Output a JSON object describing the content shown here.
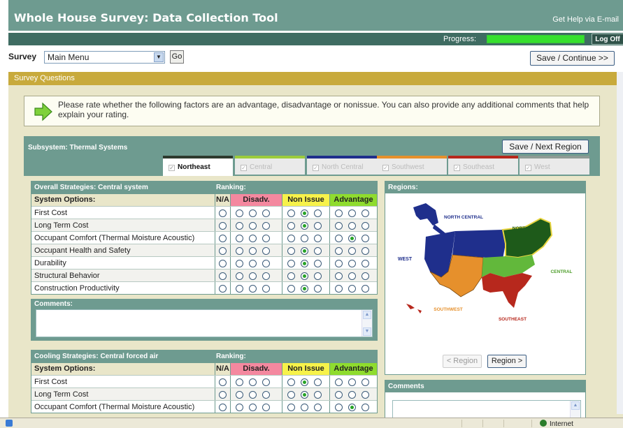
{
  "header": {
    "title": "Whole House Survey: Data Collection Tool",
    "help_link": "Get Help via E-mail"
  },
  "progress": {
    "label": "Progress:",
    "value_fraction": 1.0,
    "logoff_label": "Log Off"
  },
  "survey_bar": {
    "label": "Survey",
    "selected": "Main Menu",
    "go_label": "Go",
    "save_continue_label": "Save / Continue >>"
  },
  "section": {
    "title": "Survey Questions"
  },
  "instructions": "Please rate whether the following factors are an advantage, disadvantage or nonissue. You can also provide any additional comments that help explain your rating.",
  "subsystem": {
    "title": "Subsystem: Thermal Systems",
    "save_next_label": "Save / Next Region",
    "tabs": [
      {
        "label": "Northeast",
        "color": "#2e3a2e",
        "active": true
      },
      {
        "label": "Central",
        "color": "#9ccc3c",
        "active": false
      },
      {
        "label": "North Central",
        "color": "#1f2f8c",
        "active": false
      },
      {
        "label": "Southwest",
        "color": "#e6902c",
        "active": false
      },
      {
        "label": "Southeast",
        "color": "#b7281d",
        "active": false
      },
      {
        "label": "West",
        "color": "#8f9b95",
        "active": false
      }
    ]
  },
  "grid1": {
    "title": "Overall Strategies: Central system",
    "ranking_label": "Ranking:",
    "columns": {
      "options": "System Options:",
      "na": "N/A",
      "disadv": "Disadv.",
      "nonissue": "Non Issue",
      "advantage": "Advantage"
    },
    "rows": [
      {
        "label": "First Cost",
        "selected": 5
      },
      {
        "label": "Long Term Cost",
        "selected": 5
      },
      {
        "label": "Occupant Comfort (Thermal Moisture Acoustic)",
        "selected": 8
      },
      {
        "label": "Occupant Health and Safety",
        "selected": 5
      },
      {
        "label": "Durability",
        "selected": 5
      },
      {
        "label": "Structural Behavior",
        "selected": 5
      },
      {
        "label": "Construction Productivity",
        "selected": 5
      }
    ],
    "comments_label": "Comments:"
  },
  "grid2": {
    "title": "Cooling Strategies: Central forced air",
    "ranking_label": "Ranking:",
    "columns": {
      "options": "System Options:",
      "na": "N/A",
      "disadv": "Disadv.",
      "nonissue": "Non Issue",
      "advantage": "Advantage"
    },
    "rows": [
      {
        "label": "First Cost",
        "selected": 5
      },
      {
        "label": "Long Term Cost",
        "selected": 5
      },
      {
        "label": "Occupant Comfort (Thermal Moisture Acoustic)",
        "selected": 8
      }
    ]
  },
  "regions": {
    "title": "Regions:",
    "map_labels": {
      "north_central": "NORTH CENTRAL",
      "northeast": "NORTHEAST",
      "west": "WEST",
      "central": "CENTRAL",
      "southwest": "SOUTHWEST",
      "southeast": "SOUTHEAST"
    },
    "prev_label": "< Region",
    "next_label": "Region >"
  },
  "comments_panel": {
    "title": "Comments"
  },
  "statusbar": {
    "zone": "Internet"
  },
  "colors": {
    "header": "#6e9b90",
    "section": "#c8aa3c",
    "disadv": "#f4889f",
    "nonissue": "#f7f24a",
    "advantage": "#8fdc2e"
  }
}
